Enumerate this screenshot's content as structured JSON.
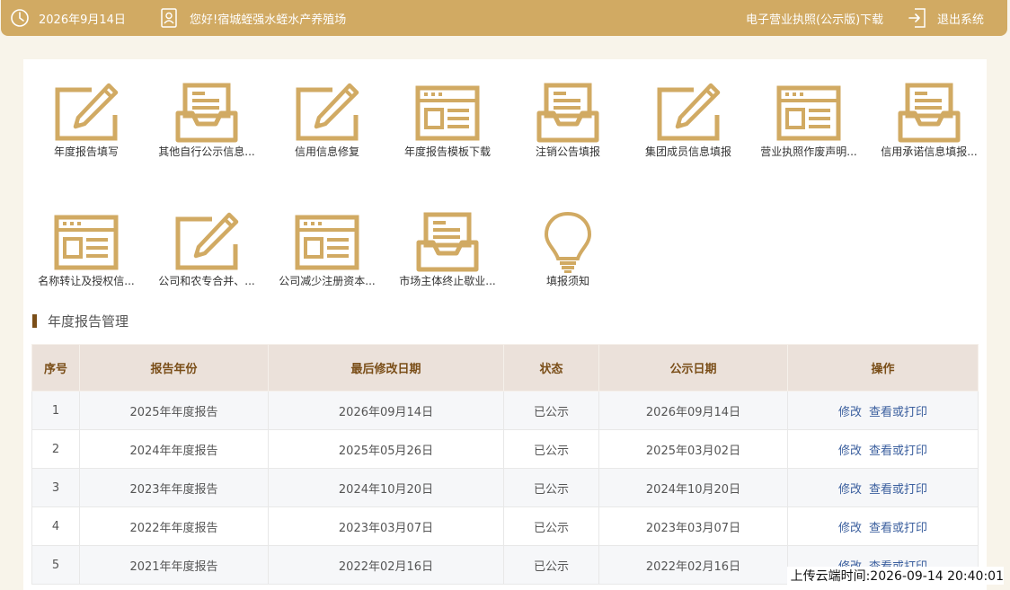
{
  "topbar": {
    "date": "2026年9月14日",
    "greeting": "您好!宿城蛭强水蛭水产养殖场",
    "license_link": "电子营业执照(公示版)下载",
    "logout": "退出系统"
  },
  "colors": {
    "accent": "#d1aa63",
    "dark_accent": "#7a4e18",
    "link": "#3b5f9e"
  },
  "tiles": [
    {
      "label": "年度报告填写",
      "icon": "pencil-form-icon"
    },
    {
      "label": "其他自行公示信息...",
      "icon": "inbox-tray-icon"
    },
    {
      "label": "信用信息修复",
      "icon": "pencil-form-icon"
    },
    {
      "label": "年度报告模板下载",
      "icon": "browser-window-icon"
    },
    {
      "label": "注销公告填报",
      "icon": "inbox-tray-icon"
    },
    {
      "label": "集团成员信息填报",
      "icon": "pencil-form-icon"
    },
    {
      "label": "营业执照作废声明...",
      "icon": "browser-window-icon"
    },
    {
      "label": "信用承诺信息填报...",
      "icon": "inbox-tray-icon"
    },
    {
      "label": "名称转让及授权信...",
      "icon": "browser-window-icon"
    },
    {
      "label": "公司和农专合并、...",
      "icon": "pencil-form-icon"
    },
    {
      "label": "公司减少注册资本...",
      "icon": "browser-window-icon"
    },
    {
      "label": "市场主体终止歇业...",
      "icon": "inbox-tray-icon"
    },
    {
      "label": "填报须知",
      "icon": "lightbulb-icon"
    }
  ],
  "section_title": "年度报告管理",
  "table": {
    "headers": [
      "序号",
      "报告年份",
      "最后修改日期",
      "状态",
      "公示日期",
      "操作"
    ],
    "rows": [
      {
        "no": "1",
        "year": "2025年年度报告",
        "modified": "2026年09月14日",
        "status": "已公示",
        "published": "2026年09月14日",
        "edit": "修改",
        "view": "查看或打印"
      },
      {
        "no": "2",
        "year": "2024年年度报告",
        "modified": "2025年05月26日",
        "status": "已公示",
        "published": "2025年03月02日",
        "edit": "修改",
        "view": "查看或打印"
      },
      {
        "no": "3",
        "year": "2023年年度报告",
        "modified": "2024年10月20日",
        "status": "已公示",
        "published": "2024年10月20日",
        "edit": "修改",
        "view": "查看或打印"
      },
      {
        "no": "4",
        "year": "2022年年度报告",
        "modified": "2023年03月07日",
        "status": "已公示",
        "published": "2023年03月07日",
        "edit": "修改",
        "view": "查看或打印"
      },
      {
        "no": "5",
        "year": "2021年年度报告",
        "modified": "2022年02月16日",
        "status": "已公示",
        "published": "2022年02月16日",
        "edit": "修改",
        "view": "查看或打印"
      }
    ]
  },
  "upload_time": "上传云端时间:2026-09-14 20:40:01"
}
